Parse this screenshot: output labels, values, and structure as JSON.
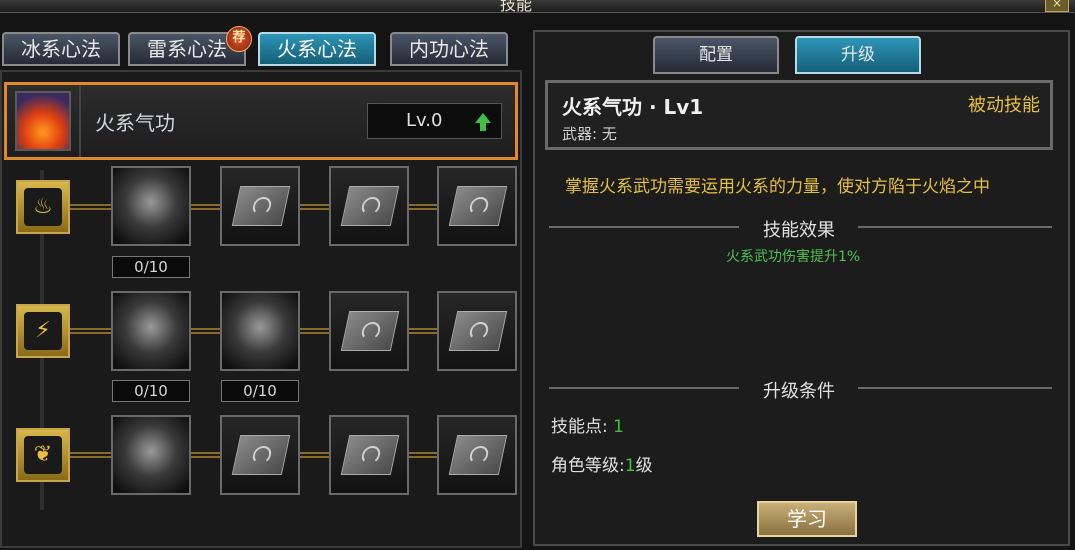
{
  "window": {
    "title": "技能",
    "close_glyph": "×"
  },
  "left_tabs": [
    {
      "label": "冰系心法",
      "active": false
    },
    {
      "label": "雷系心法",
      "active": false,
      "badge": "荐"
    },
    {
      "label": "火系心法",
      "active": true
    },
    {
      "label": "内功心法",
      "active": false
    }
  ],
  "school": {
    "name": "火系气功",
    "level": "Lv.0",
    "icon": "flame-icon",
    "upgrade_icon": "green-arrow-up-icon"
  },
  "categories": [
    {
      "icon": "fire-sigil-icon",
      "glyph": "♨"
    },
    {
      "icon": "claw-slash-icon",
      "glyph": "⚡"
    },
    {
      "icon": "shield-leaf-icon",
      "glyph": "❦"
    }
  ],
  "skill_rows": [
    {
      "slots": [
        {
          "type": "skill",
          "icon": "blade-arc-icon",
          "count": "0/10"
        },
        {
          "type": "locked",
          "icon": "locked-book-icon"
        },
        {
          "type": "locked",
          "icon": "locked-book-icon"
        },
        {
          "type": "locked",
          "icon": "locked-book-icon"
        }
      ]
    },
    {
      "slots": [
        {
          "type": "skill",
          "icon": "comet-strike-icon",
          "count": "0/10"
        },
        {
          "type": "skill",
          "icon": "fireball-burst-icon",
          "count": "0/10"
        },
        {
          "type": "locked",
          "icon": "locked-book-icon"
        },
        {
          "type": "locked",
          "icon": "locked-book-icon"
        }
      ]
    },
    {
      "slots": [
        {
          "type": "skill",
          "icon": "sun-nova-icon"
        },
        {
          "type": "locked",
          "icon": "locked-book-icon"
        },
        {
          "type": "locked",
          "icon": "locked-book-icon"
        },
        {
          "type": "locked",
          "icon": "locked-book-icon"
        }
      ]
    }
  ],
  "right_tabs": [
    {
      "label": "配置",
      "active": false
    },
    {
      "label": "升级",
      "active": true
    }
  ],
  "detail": {
    "title": "火系气功 · Lv1",
    "weapon_label": "武器:",
    "weapon_value": "无",
    "type": "被动技能",
    "description": "掌握火系武功需要运用火系的力量，使对方陷于火焰之中",
    "effect_heading": "技能效果",
    "effect_text": "火系武功伤害提升1%",
    "cond_heading": "升级条件",
    "cond_points_label": "技能点:",
    "cond_points_value": "1",
    "cond_level_label": "角色等级:",
    "cond_level_value": "1",
    "cond_level_unit": "级",
    "learn_label": "学习"
  },
  "colors": {
    "accent_orange": "#e08a2a",
    "active_tab": "#2d95b8",
    "gold_text": "#e6c040",
    "green_text": "#3ec23e"
  }
}
